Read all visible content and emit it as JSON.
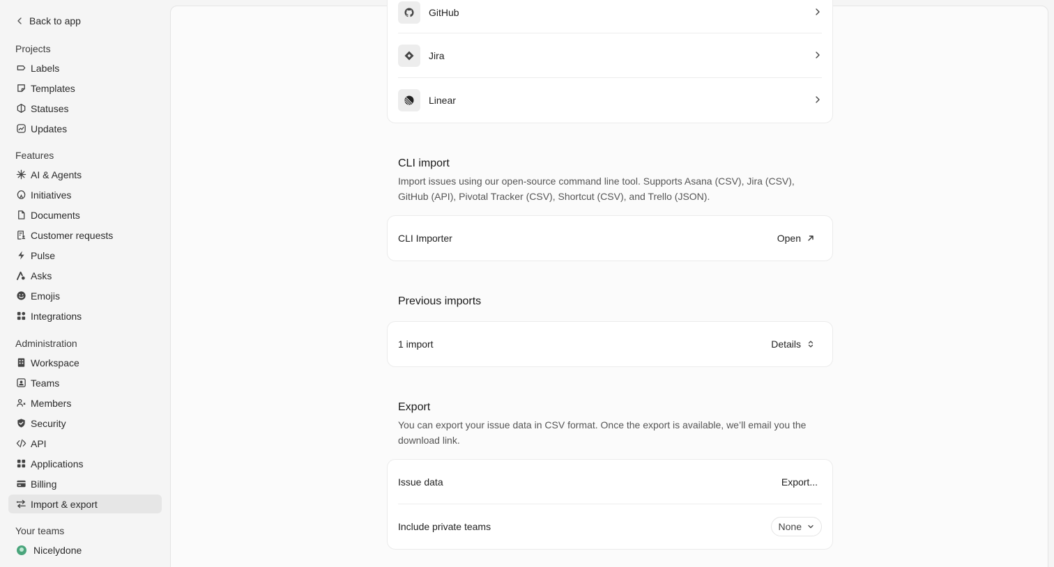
{
  "sidebar": {
    "back_label": "Back to app",
    "sections": {
      "projects": "Projects",
      "features": "Features",
      "administration": "Administration",
      "your_teams": "Your teams"
    },
    "projects": [
      "Labels",
      "Templates",
      "Statuses",
      "Updates"
    ],
    "features": [
      "AI & Agents",
      "Initiatives",
      "Documents",
      "Customer requests",
      "Pulse",
      "Asks",
      "Emojis",
      "Integrations"
    ],
    "administration": [
      "Workspace",
      "Teams",
      "Members",
      "Security",
      "API",
      "Applications",
      "Billing",
      "Import & export"
    ],
    "teams": [
      "Nicelydone"
    ],
    "active_item": "Import & export"
  },
  "integrations": {
    "items": [
      {
        "label": "GitHub",
        "icon": "github-icon"
      },
      {
        "label": "Jira",
        "icon": "jira-icon"
      },
      {
        "label": "Linear",
        "icon": "linear-icon"
      }
    ]
  },
  "cli": {
    "title": "CLI import",
    "description_line1": "Import issues using our open-source command line tool. Supports Asana (CSV), Jira (CSV),",
    "description_line2": "GitHub (API), Pivotal Tracker (CSV), Shortcut (CSV), and Trello (JSON).",
    "row_label": "CLI Importer",
    "action_label": "Open"
  },
  "previous": {
    "title": "Previous imports",
    "row_label": "1 import",
    "action_label": "Details"
  },
  "export": {
    "title": "Export",
    "description_line1": "You can export your issue data in CSV format. Once the export is available, we’ll email you the",
    "description_line2": "download link.",
    "issue_label": "Issue data",
    "issue_action": "Export...",
    "private_label": "Include private teams",
    "private_value": "None"
  },
  "colors": {
    "active_bg": "#e6e6e6",
    "team_color": "#4aa57c"
  }
}
